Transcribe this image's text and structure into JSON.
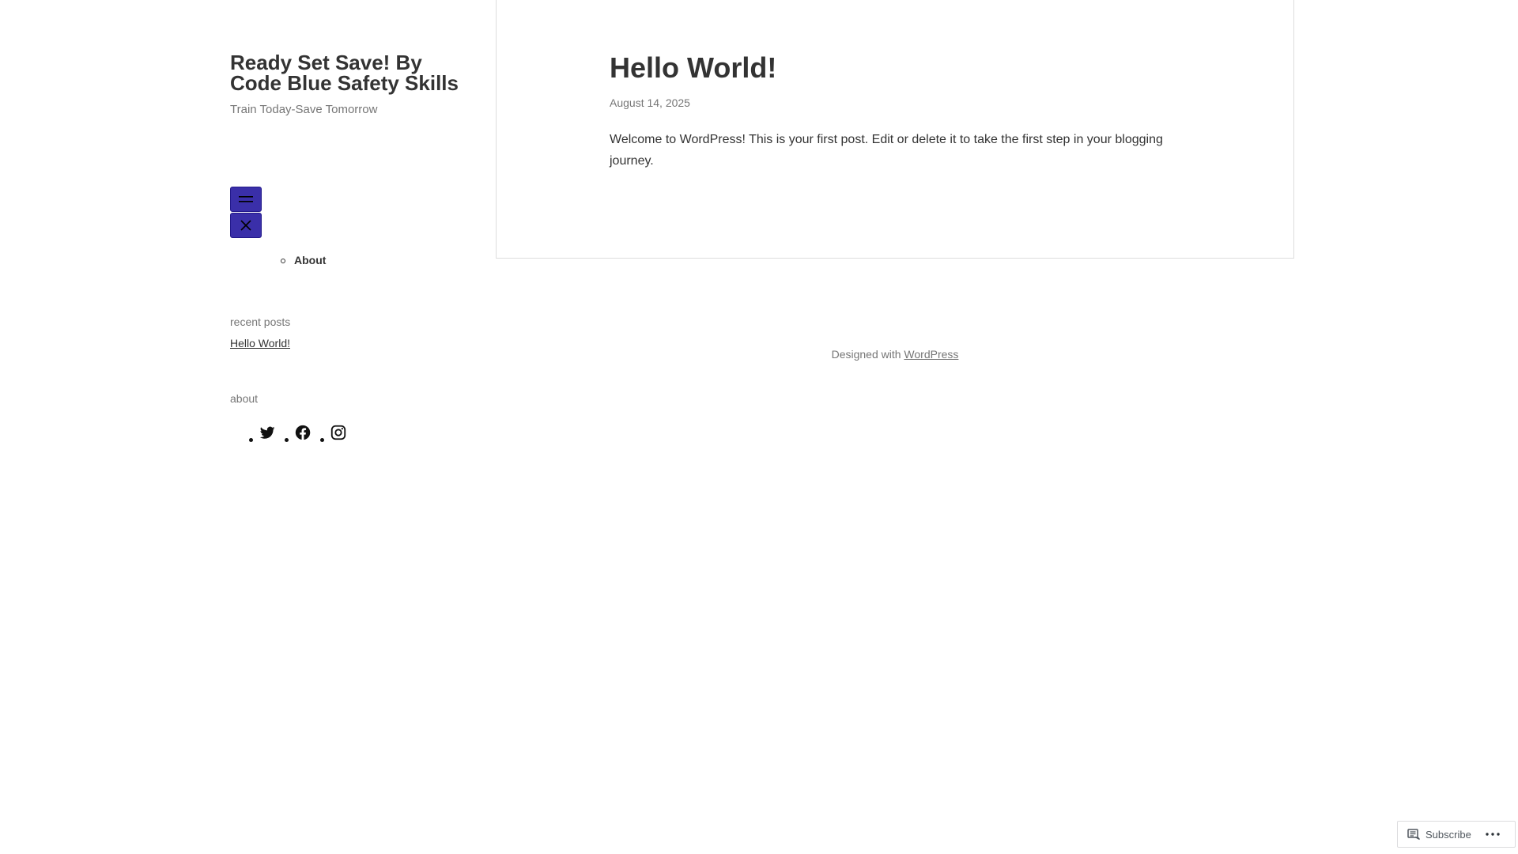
{
  "site": {
    "title": "Ready Set Save! By Code Blue Safety Skills",
    "tagline": "Train Today-Save Tomorrow"
  },
  "nav": {
    "items": [
      {
        "label": "About"
      }
    ]
  },
  "widgets": {
    "recent_posts_title": "recent posts",
    "recent_posts": [
      {
        "label": "Hello World!"
      }
    ],
    "about_title": "about",
    "social_icons": [
      "twitter-icon",
      "facebook-icon",
      "instagram-icon"
    ]
  },
  "post": {
    "title": "Hello World!",
    "date": "August 14, 2025",
    "body": "Welcome to WordPress! This is your first post. Edit or delete it to take the first step in your blogging journey."
  },
  "footer": {
    "credit_prefix": "Designed with",
    "credit_link": "WordPress"
  },
  "subscribe": {
    "label": "Subscribe"
  },
  "colors": {
    "menu_button": "#3a2fa9",
    "text": "#333333",
    "muted": "#767676"
  }
}
